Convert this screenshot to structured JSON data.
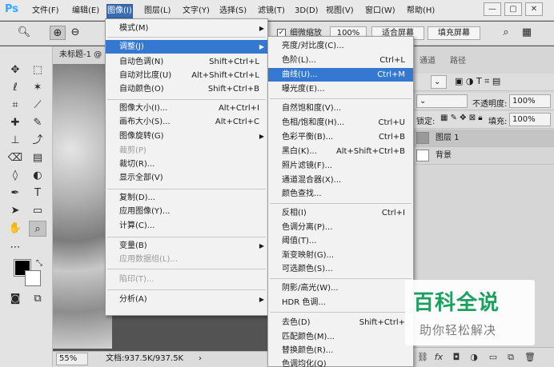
{
  "menubar": {
    "logo": "Ps",
    "items": [
      "文件(F)",
      "编辑(E)",
      "图像(I)",
      "图层(L)",
      "文字(Y)",
      "选择(S)",
      "滤镜(T)",
      "3D(D)",
      "视图(V)",
      "窗口(W)",
      "帮助(H)"
    ],
    "active_item": "图像(I)",
    "window_controls": [
      "—",
      "▢",
      "✕"
    ]
  },
  "options_bar": {
    "checkbox_label": "细微缩放",
    "zoom_value": "100%",
    "fit_screen_button": "适合屏幕",
    "fill_screen_button": "填充屏幕"
  },
  "document": {
    "tab_title": "未标题-1 @",
    "zoom": "55%",
    "doc_info": "文档:937.5K/937.5K"
  },
  "right_panel": {
    "tabs": [
      "通道",
      "路径"
    ],
    "opacity_label": "不透明度:",
    "opacity_value": "100%",
    "lock_label": "锁定:",
    "fill_label": "填充:",
    "fill_value": "100%",
    "layers": [
      "图层 1",
      "背景"
    ]
  },
  "image_menu": {
    "items": [
      {
        "label": "模式(M)",
        "shortcut": "",
        "submenu": true
      },
      {
        "label": "调整(J)",
        "shortcut": "",
        "submenu": true,
        "highlighted": true
      },
      {
        "label": "自动色调(N)",
        "shortcut": "Shift+Ctrl+L"
      },
      {
        "label": "自动对比度(U)",
        "shortcut": "Alt+Shift+Ctrl+L"
      },
      {
        "label": "自动颜色(O)",
        "shortcut": "Shift+Ctrl+B"
      },
      {
        "label": "图像大小(I)...",
        "shortcut": "Alt+Ctrl+I"
      },
      {
        "label": "画布大小(S)...",
        "shortcut": "Alt+Ctrl+C"
      },
      {
        "label": "图像旋转(G)",
        "shortcut": "",
        "submenu": true
      },
      {
        "label": "裁剪(P)",
        "shortcut": "",
        "disabled": true
      },
      {
        "label": "裁切(R)...",
        "shortcut": ""
      },
      {
        "label": "显示全部(V)",
        "shortcut": ""
      },
      {
        "label": "复制(D)...",
        "shortcut": ""
      },
      {
        "label": "应用图像(Y)...",
        "shortcut": ""
      },
      {
        "label": "计算(C)...",
        "shortcut": ""
      },
      {
        "label": "变量(B)",
        "shortcut": "",
        "submenu": true
      },
      {
        "label": "应用数据组(L)...",
        "shortcut": "",
        "disabled": true
      },
      {
        "label": "陷印(T)...",
        "shortcut": "",
        "disabled": true
      },
      {
        "label": "分析(A)",
        "shortcut": "",
        "submenu": true
      }
    ]
  },
  "adjust_menu": {
    "items": [
      {
        "label": "亮度/对比度(C)...",
        "shortcut": ""
      },
      {
        "label": "色阶(L)...",
        "shortcut": "Ctrl+L"
      },
      {
        "label": "曲线(U)...",
        "shortcut": "Ctrl+M",
        "highlighted": true
      },
      {
        "label": "曝光度(E)...",
        "shortcut": ""
      },
      {
        "label": "自然饱和度(V)...",
        "shortcut": ""
      },
      {
        "label": "色相/饱和度(H)...",
        "shortcut": "Ctrl+U"
      },
      {
        "label": "色彩平衡(B)...",
        "shortcut": "Ctrl+B"
      },
      {
        "label": "黑白(K)...",
        "shortcut": "Alt+Shift+Ctrl+B"
      },
      {
        "label": "照片滤镜(F)...",
        "shortcut": ""
      },
      {
        "label": "通道混合器(X)...",
        "shortcut": ""
      },
      {
        "label": "颜色查找...",
        "shortcut": ""
      },
      {
        "label": "反相(I)",
        "shortcut": "Ctrl+I"
      },
      {
        "label": "色调分离(P)...",
        "shortcut": ""
      },
      {
        "label": "阈值(T)...",
        "shortcut": ""
      },
      {
        "label": "渐变映射(G)...",
        "shortcut": ""
      },
      {
        "label": "可选颜色(S)...",
        "shortcut": ""
      },
      {
        "label": "阴影/高光(W)...",
        "shortcut": ""
      },
      {
        "label": "HDR 色调...",
        "shortcut": ""
      },
      {
        "label": "去色(D)",
        "shortcut": "Shift+Ctrl+"
      },
      {
        "label": "匹配颜色(M)...",
        "shortcut": ""
      },
      {
        "label": "替换颜色(R)...",
        "shortcut": ""
      },
      {
        "label": "色调均化(Q)",
        "shortcut": ""
      }
    ]
  },
  "watermark": {
    "title": "百科全说",
    "subtitle": "助你轻松解决"
  },
  "colors": {
    "menu_highlight": "#3478d2",
    "active_menubar": "#3a6cb4",
    "ps_logo": "#31a8ff",
    "watermark_green": "#1aa05f"
  }
}
